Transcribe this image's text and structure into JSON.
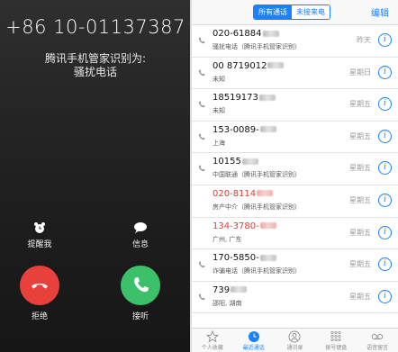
{
  "call": {
    "number": "+86 10-01137387",
    "id_line": "腾讯手机管家识别为:",
    "tag": "骚扰电话",
    "remind_label": "提醒我",
    "message_label": "信息",
    "decline_label": "拒绝",
    "accept_label": "接听",
    "decline_color": "#e8403b",
    "accept_color": "#3cc16a"
  },
  "recents": {
    "segments": [
      "所有通话",
      "未接来电"
    ],
    "active_segment": "所有通话",
    "edit_label": "编辑",
    "rows": [
      {
        "number": "020-61884",
        "sub": "骚扰电话（腾讯手机管家识别）",
        "day": "昨天",
        "missed": false
      },
      {
        "number": "00 8719012",
        "sub": "未知",
        "day": "星期日",
        "missed": false
      },
      {
        "number": "18519173",
        "sub": "未知",
        "day": "星期五",
        "missed": false
      },
      {
        "number": "153-0089-",
        "sub": "上海",
        "day": "星期五",
        "missed": false
      },
      {
        "number": "10155",
        "sub": "中国联通（腾讯手机管家识别）",
        "day": "星期五",
        "missed": false
      },
      {
        "number": "020-8114",
        "sub": "房产中介（腾讯手机管家识别）",
        "day": "星期五",
        "missed": true
      },
      {
        "number": "134-3780-",
        "sub": "广州, 广东",
        "day": "星期五",
        "missed": true
      },
      {
        "number": "170-5850-",
        "sub": "诈骗电话（腾讯手机管家识别）",
        "day": "星期五",
        "missed": false
      },
      {
        "number": "739",
        "sub": "邵阳, 湖南",
        "day": "星期五",
        "missed": false
      }
    ],
    "tabs": [
      {
        "label": "个人收藏",
        "icon": "star-icon"
      },
      {
        "label": "最近通话",
        "icon": "clock-icon"
      },
      {
        "label": "通讯录",
        "icon": "contacts-icon"
      },
      {
        "label": "拨号键盘",
        "icon": "keypad-icon"
      },
      {
        "label": "语音留言",
        "icon": "voicemail-icon"
      }
    ],
    "active_tab": "最近通话",
    "accent_color": "#1a82fb",
    "missed_color": "#e53935"
  }
}
